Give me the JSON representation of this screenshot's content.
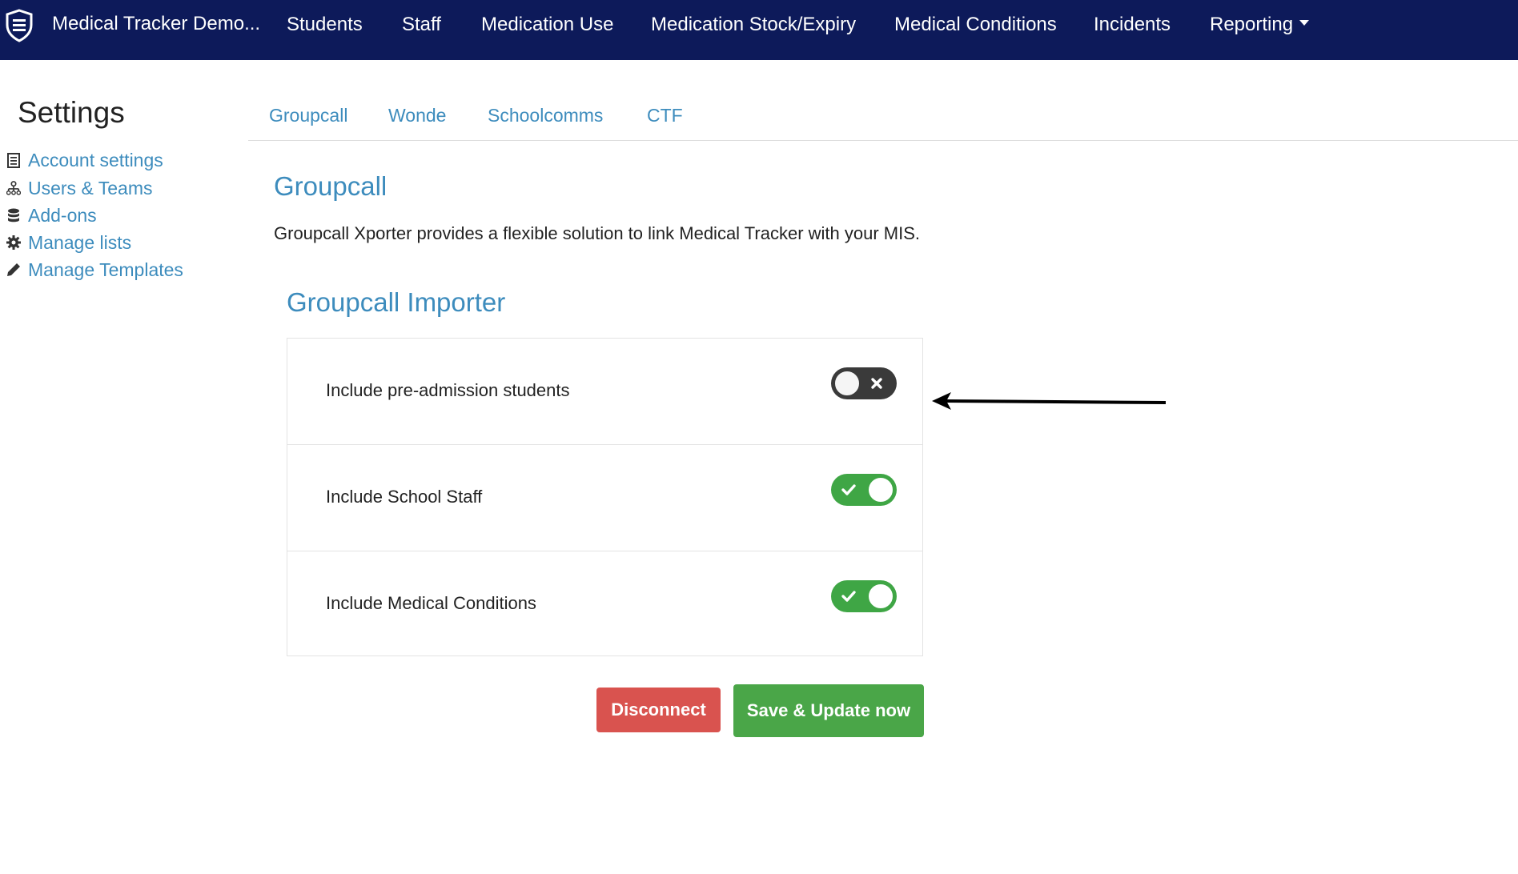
{
  "navbar": {
    "brand": "Medical Tracker Demo...",
    "items": [
      {
        "label": "Students"
      },
      {
        "label": "Staff"
      },
      {
        "label": "Medication Use"
      },
      {
        "label": "Medication Stock/Expiry"
      },
      {
        "label": "Medical Conditions"
      },
      {
        "label": "Incidents"
      },
      {
        "label": "Reporting"
      }
    ]
  },
  "sidebar": {
    "title": "Settings",
    "items": [
      {
        "label": "Account settings",
        "icon": "document-list-icon"
      },
      {
        "label": "Users & Teams",
        "icon": "org-chart-icon"
      },
      {
        "label": "Add-ons",
        "icon": "database-icon"
      },
      {
        "label": "Manage lists",
        "icon": "gear-icon"
      },
      {
        "label": "Manage Templates",
        "icon": "pencil-icon"
      }
    ]
  },
  "tabs": [
    {
      "label": "Groupcall"
    },
    {
      "label": "Wonde"
    },
    {
      "label": "Schoolcomms"
    },
    {
      "label": "CTF"
    }
  ],
  "main": {
    "title": "Groupcall",
    "description": "Groupcall Xporter provides a flexible solution to link Medical Tracker with your MIS.",
    "importer_title": "Groupcall Importer",
    "options": [
      {
        "label": "Include pre-admission students",
        "enabled": false
      },
      {
        "label": "Include School Staff",
        "enabled": true
      },
      {
        "label": "Include Medical Conditions",
        "enabled": true
      }
    ],
    "disconnect_label": "Disconnect",
    "save_label": "Save & Update now"
  },
  "colors": {
    "navbar": "#0d1a5a",
    "link": "#3d8cbd",
    "toggle_on": "#3fa645",
    "toggle_off": "#3a3a3a",
    "danger": "#d9534f",
    "success": "#4aa648"
  }
}
